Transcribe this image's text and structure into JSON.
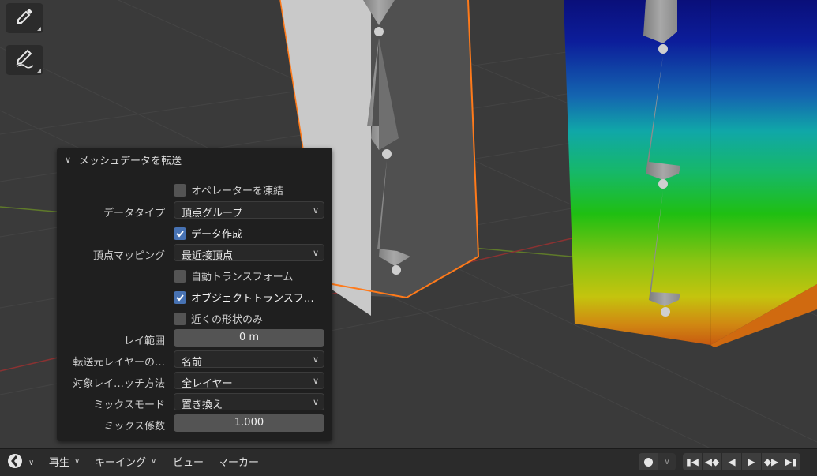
{
  "tools": [
    {
      "icon": "eyedropper-icon"
    },
    {
      "icon": "annotate-pen-icon"
    }
  ],
  "operator_panel": {
    "title": "メッシュデータを転送",
    "rows": {
      "freeze": {
        "label": "オペレーターを凍結",
        "checked": false
      },
      "data_type": {
        "label": "データタイプ",
        "value": "頂点グループ"
      },
      "create_data": {
        "label": "データ作成",
        "checked": true
      },
      "vertex_mapping": {
        "label": "頂点マッピング",
        "value": "最近接頂点"
      },
      "auto_transform": {
        "label": "自動トランスフォーム",
        "checked": false
      },
      "object_transform": {
        "label": "オブジェクトトランスフ…",
        "checked": true
      },
      "only_neighbor": {
        "label": "近くの形状のみ",
        "checked": false
      },
      "ray_radius": {
        "label": "レイ範囲",
        "value": "0 m"
      },
      "source_layers": {
        "label": "転送元レイヤーの…",
        "value": "名前"
      },
      "dest_layers": {
        "label": "対象レイ…ッチ方法",
        "value": "全レイヤー"
      },
      "mix_mode": {
        "label": "ミックスモード",
        "value": "置き換え"
      },
      "mix_factor": {
        "label": "ミックス係数",
        "value": "1.000"
      }
    }
  },
  "timeline": {
    "editor_icon": "clock-icon",
    "playback": "再生",
    "keying": "キーイング",
    "view": "ビュー",
    "marker": "マーカー",
    "controls": [
      "jump-start-icon",
      "prev-keyframe-icon",
      "play-reverse-icon",
      "play-icon",
      "next-keyframe-icon",
      "jump-end-icon"
    ]
  },
  "colors": {
    "selection_outline": "#ff7a1a",
    "checkbox_on": "#4772b3"
  }
}
